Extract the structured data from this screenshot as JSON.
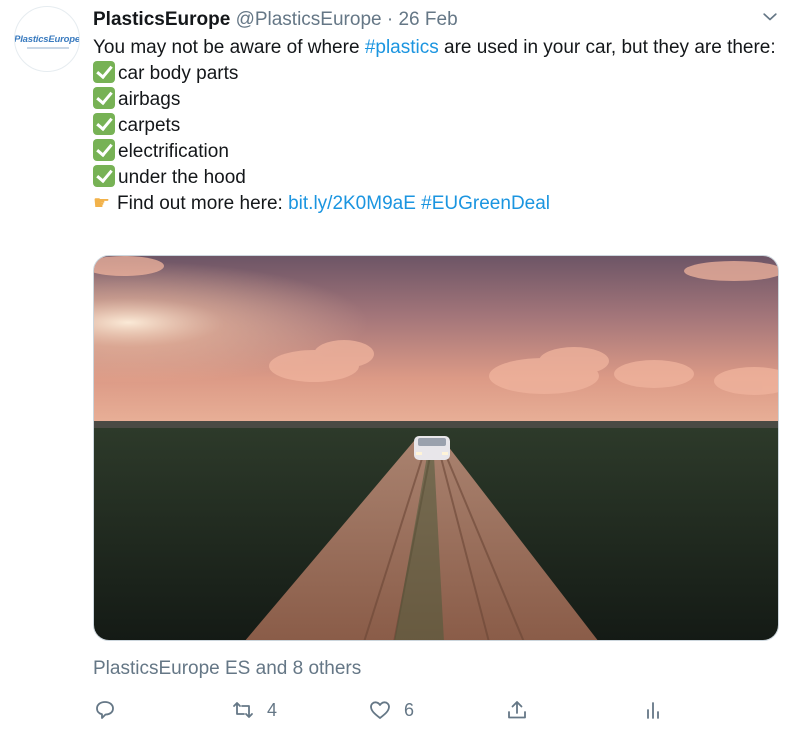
{
  "tweet": {
    "avatar_text": "PlasticsEurope",
    "author_name": "PlasticsEurope",
    "author_handle": "@PlasticsEurope",
    "separator": "·",
    "date": "26 Feb",
    "line1_pre": "You may not be aware of where ",
    "hashtag_plastics": "#plastics",
    "line1_post": " are used in your car, but they are there:",
    "items": [
      "car body parts",
      "airbags",
      "carpets",
      "electrification",
      "under the hood"
    ],
    "find_out_text": "Find out more here: ",
    "short_link": "bit.ly/2K0M9aE",
    "hashtag_green": "#EUGreenDeal",
    "liked_by": "PlasticsEurope ES and 8 others",
    "retweet_count": "4",
    "like_count": "6"
  },
  "icons": {
    "caret": "chevron-down-icon",
    "reply": "reply-icon",
    "retweet": "retweet-icon",
    "like": "heart-icon",
    "share": "share-icon",
    "analytics": "analytics-icon"
  },
  "colors": {
    "link": "#1b95e0",
    "muted": "#657786",
    "text": "#14171a",
    "check": "#77b255"
  }
}
